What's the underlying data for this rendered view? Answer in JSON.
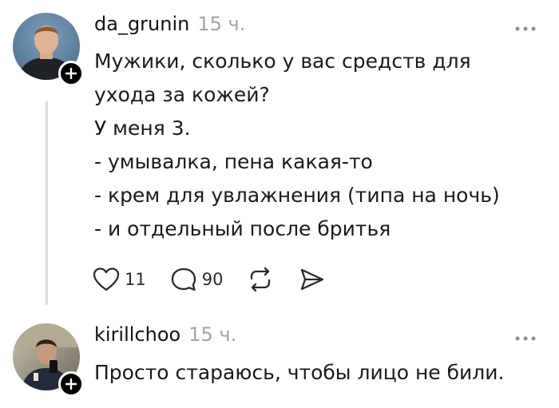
{
  "posts": [
    {
      "author": "da_grunin",
      "time": "15 ч.",
      "lines": [
        "Мужики, сколько у вас средств для",
        "ухода за кожей?",
        "У меня 3.",
        "- умывалка, пена какая-то",
        "- крем для увлажнения (типа на ночь)",
        "- и отдельный после бритья"
      ],
      "likes": "11",
      "replies": "90"
    },
    {
      "author": "kirillchoo",
      "time": "15 ч.",
      "lines": [
        "Просто стараюсь, чтобы лицо не били."
      ]
    }
  ],
  "icons": {
    "like": "heart-icon",
    "reply": "comment-bubble-icon",
    "repost": "repost-icon",
    "share": "send-icon",
    "more": "more-horizontal-icon",
    "follow": "plus-icon"
  },
  "colors": {
    "text": "#1a1a1a",
    "muted": "#a3a3a3",
    "thread_line": "#dcdcdc",
    "badge": "#000000"
  }
}
